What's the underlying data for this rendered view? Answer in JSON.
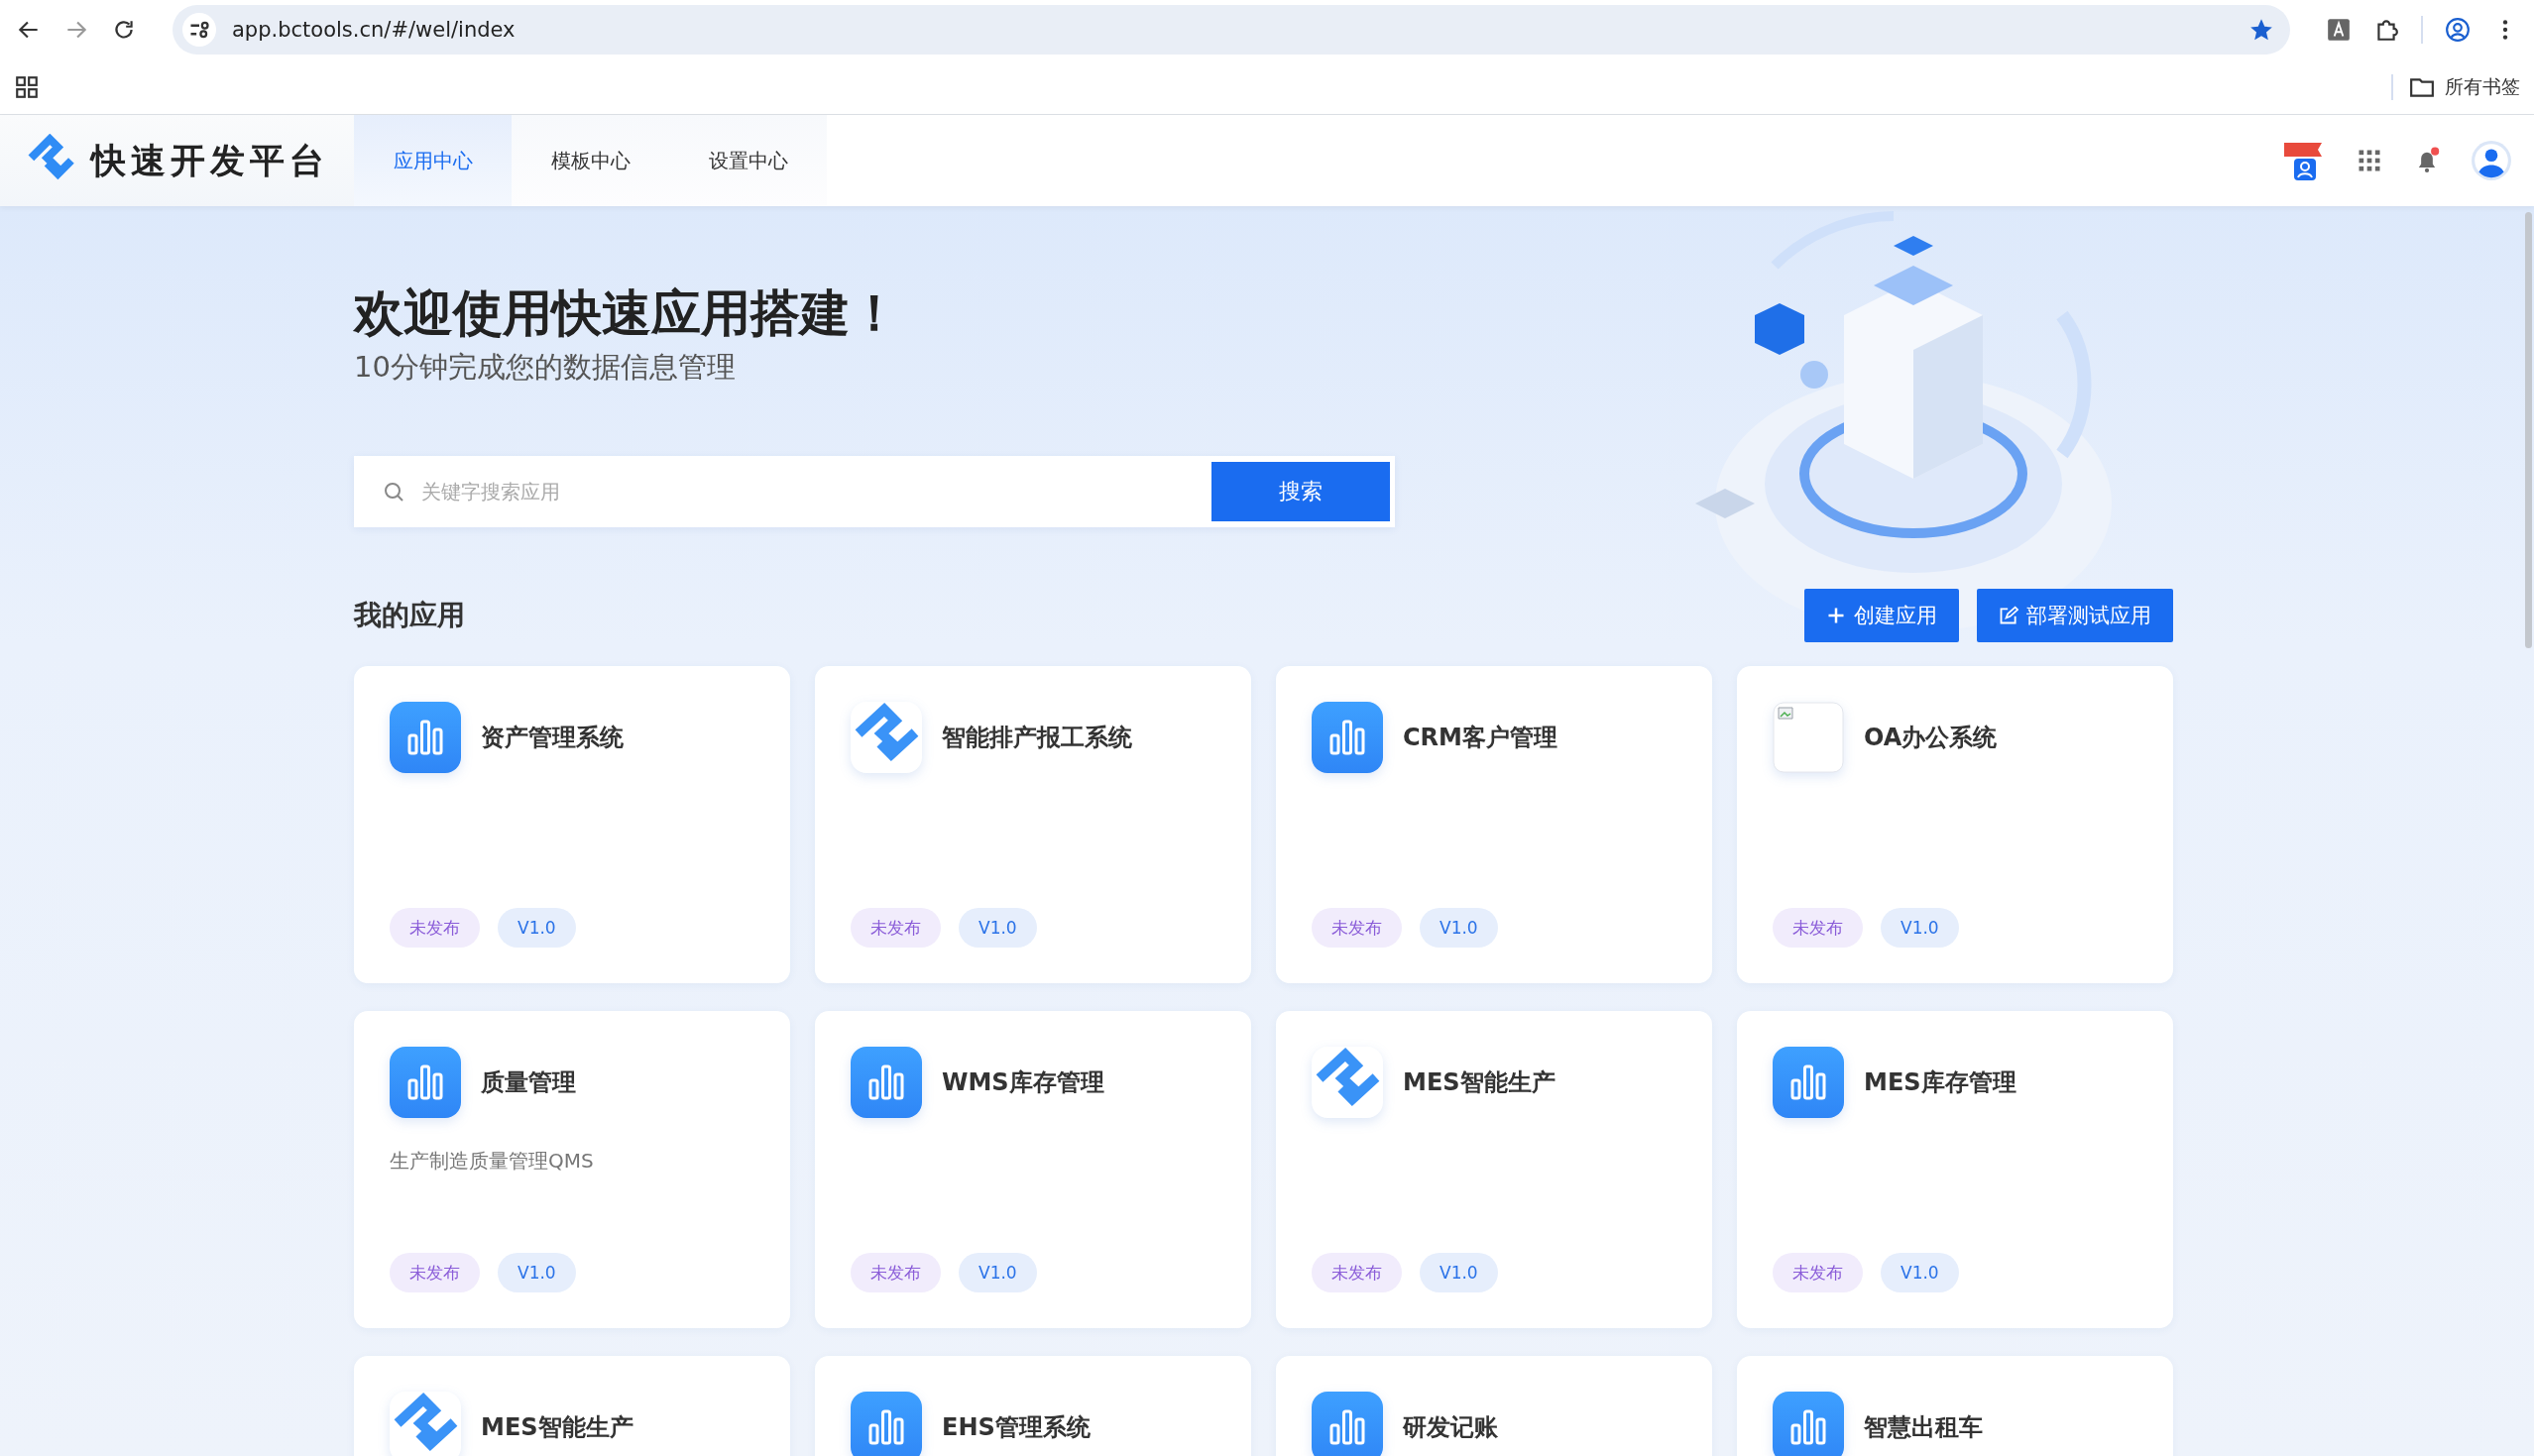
{
  "browser": {
    "url": "app.bctools.cn/#/wel/index",
    "bookmark_folder": "所有书签"
  },
  "header": {
    "brand": "快速开发平台",
    "notification_unread": true,
    "tabs": [
      {
        "label": "应用中心",
        "selected": true
      },
      {
        "label": "模板中心",
        "selected": false
      },
      {
        "label": "设置中心",
        "selected": false
      }
    ]
  },
  "hero": {
    "title": "欢迎使用快速应用搭建！",
    "subtitle": "10分钟完成您的数据信息管理",
    "search": {
      "placeholder": "关键字搜索应用",
      "button": "搜索"
    }
  },
  "my_apps": {
    "title": "我的应用",
    "actions": [
      {
        "label": "创建应用",
        "kind": "create"
      },
      {
        "label": "部署测试应用",
        "kind": "deploy"
      }
    ],
    "apps": [
      {
        "name": "资产管理系统",
        "kind": "chart",
        "tags": [
          {
            "label": "未发布",
            "kind": "status"
          },
          {
            "label": "V1.0",
            "kind": "version"
          }
        ]
      },
      {
        "name": "智能排产报工系统",
        "kind": "logo",
        "tags": [
          {
            "label": "未发布",
            "kind": "status"
          },
          {
            "label": "V1.0",
            "kind": "version"
          }
        ]
      },
      {
        "name": "CRM客户管理",
        "kind": "chart",
        "tags": [
          {
            "label": "未发布",
            "kind": "status"
          },
          {
            "label": "V1.0",
            "kind": "version"
          }
        ]
      },
      {
        "name": "OA办公系统",
        "kind": "broken",
        "tags": [
          {
            "label": "未发布",
            "kind": "status"
          },
          {
            "label": "V1.0",
            "kind": "version"
          }
        ]
      },
      {
        "name": "质量管理",
        "kind": "chart",
        "description": "生产制造质量管理QMS",
        "tags": [
          {
            "label": "未发布",
            "kind": "status"
          },
          {
            "label": "V1.0",
            "kind": "version"
          }
        ]
      },
      {
        "name": "WMS库存管理",
        "kind": "chart",
        "tags": [
          {
            "label": "未发布",
            "kind": "status"
          },
          {
            "label": "V1.0",
            "kind": "version"
          }
        ]
      },
      {
        "name": "MES智能生产",
        "kind": "logo",
        "tags": [
          {
            "label": "未发布",
            "kind": "status"
          },
          {
            "label": "V1.0",
            "kind": "version"
          }
        ]
      },
      {
        "name": "MES库存管理",
        "kind": "chart",
        "tags": [
          {
            "label": "未发布",
            "kind": "status"
          },
          {
            "label": "V1.0",
            "kind": "version"
          }
        ]
      },
      {
        "name": "MES智能生产",
        "kind": "logo"
      },
      {
        "name": "EHS管理系统",
        "kind": "chart"
      },
      {
        "name": "研发记账",
        "kind": "chart"
      },
      {
        "name": "智慧出租车",
        "kind": "chart"
      }
    ]
  }
}
